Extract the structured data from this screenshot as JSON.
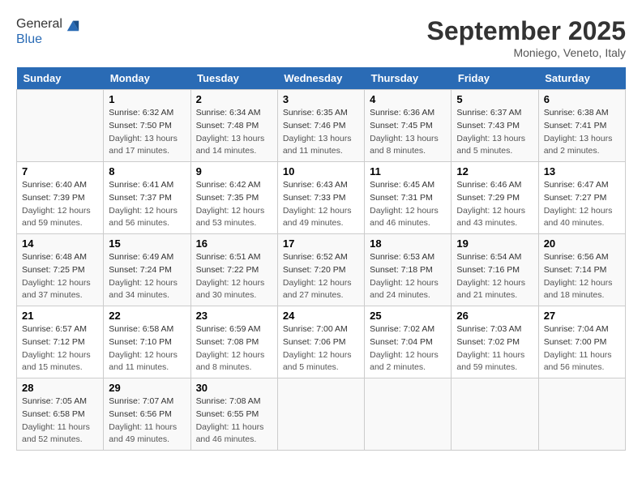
{
  "header": {
    "logo_general": "General",
    "logo_blue": "Blue",
    "month_title": "September 2025",
    "location": "Moniego, Veneto, Italy"
  },
  "weekdays": [
    "Sunday",
    "Monday",
    "Tuesday",
    "Wednesday",
    "Thursday",
    "Friday",
    "Saturday"
  ],
  "weeks": [
    [
      {
        "day": "",
        "sunrise": "",
        "sunset": "",
        "daylight": ""
      },
      {
        "day": "1",
        "sunrise": "Sunrise: 6:32 AM",
        "sunset": "Sunset: 7:50 PM",
        "daylight": "Daylight: 13 hours and 17 minutes."
      },
      {
        "day": "2",
        "sunrise": "Sunrise: 6:34 AM",
        "sunset": "Sunset: 7:48 PM",
        "daylight": "Daylight: 13 hours and 14 minutes."
      },
      {
        "day": "3",
        "sunrise": "Sunrise: 6:35 AM",
        "sunset": "Sunset: 7:46 PM",
        "daylight": "Daylight: 13 hours and 11 minutes."
      },
      {
        "day": "4",
        "sunrise": "Sunrise: 6:36 AM",
        "sunset": "Sunset: 7:45 PM",
        "daylight": "Daylight: 13 hours and 8 minutes."
      },
      {
        "day": "5",
        "sunrise": "Sunrise: 6:37 AM",
        "sunset": "Sunset: 7:43 PM",
        "daylight": "Daylight: 13 hours and 5 minutes."
      },
      {
        "day": "6",
        "sunrise": "Sunrise: 6:38 AM",
        "sunset": "Sunset: 7:41 PM",
        "daylight": "Daylight: 13 hours and 2 minutes."
      }
    ],
    [
      {
        "day": "7",
        "sunrise": "Sunrise: 6:40 AM",
        "sunset": "Sunset: 7:39 PM",
        "daylight": "Daylight: 12 hours and 59 minutes."
      },
      {
        "day": "8",
        "sunrise": "Sunrise: 6:41 AM",
        "sunset": "Sunset: 7:37 PM",
        "daylight": "Daylight: 12 hours and 56 minutes."
      },
      {
        "day": "9",
        "sunrise": "Sunrise: 6:42 AM",
        "sunset": "Sunset: 7:35 PM",
        "daylight": "Daylight: 12 hours and 53 minutes."
      },
      {
        "day": "10",
        "sunrise": "Sunrise: 6:43 AM",
        "sunset": "Sunset: 7:33 PM",
        "daylight": "Daylight: 12 hours and 49 minutes."
      },
      {
        "day": "11",
        "sunrise": "Sunrise: 6:45 AM",
        "sunset": "Sunset: 7:31 PM",
        "daylight": "Daylight: 12 hours and 46 minutes."
      },
      {
        "day": "12",
        "sunrise": "Sunrise: 6:46 AM",
        "sunset": "Sunset: 7:29 PM",
        "daylight": "Daylight: 12 hours and 43 minutes."
      },
      {
        "day": "13",
        "sunrise": "Sunrise: 6:47 AM",
        "sunset": "Sunset: 7:27 PM",
        "daylight": "Daylight: 12 hours and 40 minutes."
      }
    ],
    [
      {
        "day": "14",
        "sunrise": "Sunrise: 6:48 AM",
        "sunset": "Sunset: 7:25 PM",
        "daylight": "Daylight: 12 hours and 37 minutes."
      },
      {
        "day": "15",
        "sunrise": "Sunrise: 6:49 AM",
        "sunset": "Sunset: 7:24 PM",
        "daylight": "Daylight: 12 hours and 34 minutes."
      },
      {
        "day": "16",
        "sunrise": "Sunrise: 6:51 AM",
        "sunset": "Sunset: 7:22 PM",
        "daylight": "Daylight: 12 hours and 30 minutes."
      },
      {
        "day": "17",
        "sunrise": "Sunrise: 6:52 AM",
        "sunset": "Sunset: 7:20 PM",
        "daylight": "Daylight: 12 hours and 27 minutes."
      },
      {
        "day": "18",
        "sunrise": "Sunrise: 6:53 AM",
        "sunset": "Sunset: 7:18 PM",
        "daylight": "Daylight: 12 hours and 24 minutes."
      },
      {
        "day": "19",
        "sunrise": "Sunrise: 6:54 AM",
        "sunset": "Sunset: 7:16 PM",
        "daylight": "Daylight: 12 hours and 21 minutes."
      },
      {
        "day": "20",
        "sunrise": "Sunrise: 6:56 AM",
        "sunset": "Sunset: 7:14 PM",
        "daylight": "Daylight: 12 hours and 18 minutes."
      }
    ],
    [
      {
        "day": "21",
        "sunrise": "Sunrise: 6:57 AM",
        "sunset": "Sunset: 7:12 PM",
        "daylight": "Daylight: 12 hours and 15 minutes."
      },
      {
        "day": "22",
        "sunrise": "Sunrise: 6:58 AM",
        "sunset": "Sunset: 7:10 PM",
        "daylight": "Daylight: 12 hours and 11 minutes."
      },
      {
        "day": "23",
        "sunrise": "Sunrise: 6:59 AM",
        "sunset": "Sunset: 7:08 PM",
        "daylight": "Daylight: 12 hours and 8 minutes."
      },
      {
        "day": "24",
        "sunrise": "Sunrise: 7:00 AM",
        "sunset": "Sunset: 7:06 PM",
        "daylight": "Daylight: 12 hours and 5 minutes."
      },
      {
        "day": "25",
        "sunrise": "Sunrise: 7:02 AM",
        "sunset": "Sunset: 7:04 PM",
        "daylight": "Daylight: 12 hours and 2 minutes."
      },
      {
        "day": "26",
        "sunrise": "Sunrise: 7:03 AM",
        "sunset": "Sunset: 7:02 PM",
        "daylight": "Daylight: 11 hours and 59 minutes."
      },
      {
        "day": "27",
        "sunrise": "Sunrise: 7:04 AM",
        "sunset": "Sunset: 7:00 PM",
        "daylight": "Daylight: 11 hours and 56 minutes."
      }
    ],
    [
      {
        "day": "28",
        "sunrise": "Sunrise: 7:05 AM",
        "sunset": "Sunset: 6:58 PM",
        "daylight": "Daylight: 11 hours and 52 minutes."
      },
      {
        "day": "29",
        "sunrise": "Sunrise: 7:07 AM",
        "sunset": "Sunset: 6:56 PM",
        "daylight": "Daylight: 11 hours and 49 minutes."
      },
      {
        "day": "30",
        "sunrise": "Sunrise: 7:08 AM",
        "sunset": "Sunset: 6:55 PM",
        "daylight": "Daylight: 11 hours and 46 minutes."
      },
      {
        "day": "",
        "sunrise": "",
        "sunset": "",
        "daylight": ""
      },
      {
        "day": "",
        "sunrise": "",
        "sunset": "",
        "daylight": ""
      },
      {
        "day": "",
        "sunrise": "",
        "sunset": "",
        "daylight": ""
      },
      {
        "day": "",
        "sunrise": "",
        "sunset": "",
        "daylight": ""
      }
    ]
  ]
}
